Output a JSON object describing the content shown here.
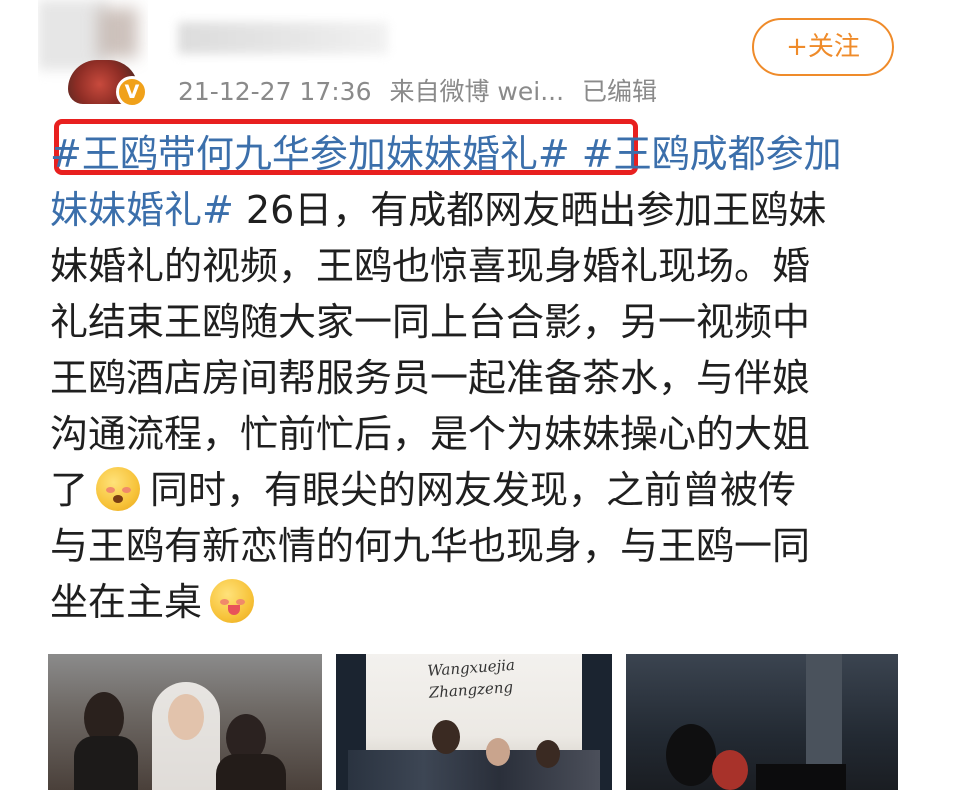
{
  "post": {
    "timestamp": "21-12-27 17:36",
    "source": "来自微博 wei...",
    "edited": "已编辑",
    "follow_label": "+关注",
    "verified_badge": "V",
    "lines": [
      [
        {
          "t": "#王鸥带何九华参加妹妹婚礼#",
          "h": true
        },
        {
          "t": " ",
          "h": false
        },
        {
          "t": "#王鸥成都参加",
          "h": true
        }
      ],
      [
        {
          "t": "妹妹婚礼#",
          "h": true
        },
        {
          "t": " 26日，有成都网友晒出参加王鸥妹",
          "h": false
        }
      ],
      [
        {
          "t": "妹婚礼的视频，王鸥也惊喜现身婚礼现场。婚",
          "h": false
        }
      ],
      [
        {
          "t": "礼结束王鸥随大家一同上台合影，另一视频中",
          "h": false
        }
      ],
      [
        {
          "t": "王鸥酒店房间帮服务员一起准备茶水，与伴娘",
          "h": false
        }
      ],
      [
        {
          "t": "沟通流程，忙前忙后，是个为妹妹操心的大姐",
          "h": false
        }
      ],
      [
        {
          "t": "了",
          "h": false
        },
        {
          "emoji": "flushed-emoji"
        },
        {
          "t": "同时，有眼尖的网友发现，之前曾被传",
          "h": false
        }
      ],
      [
        {
          "t": "与王鸥有新恋情的何九华也现身，与王鸥一同",
          "h": false
        }
      ],
      [
        {
          "t": "坐在主桌",
          "h": false
        },
        {
          "emoji": "yum-emoji"
        }
      ]
    ]
  },
  "photos": {
    "caption_1": "Wangxuejia",
    "caption_2": "Zhangzeng"
  },
  "colors": {
    "hashtag": "#3b6fab",
    "follow_accent": "#ef8b2a",
    "highlight_border": "#e8201f",
    "meta_gray": "#8a8a8a",
    "badge": "#f0a11a"
  }
}
